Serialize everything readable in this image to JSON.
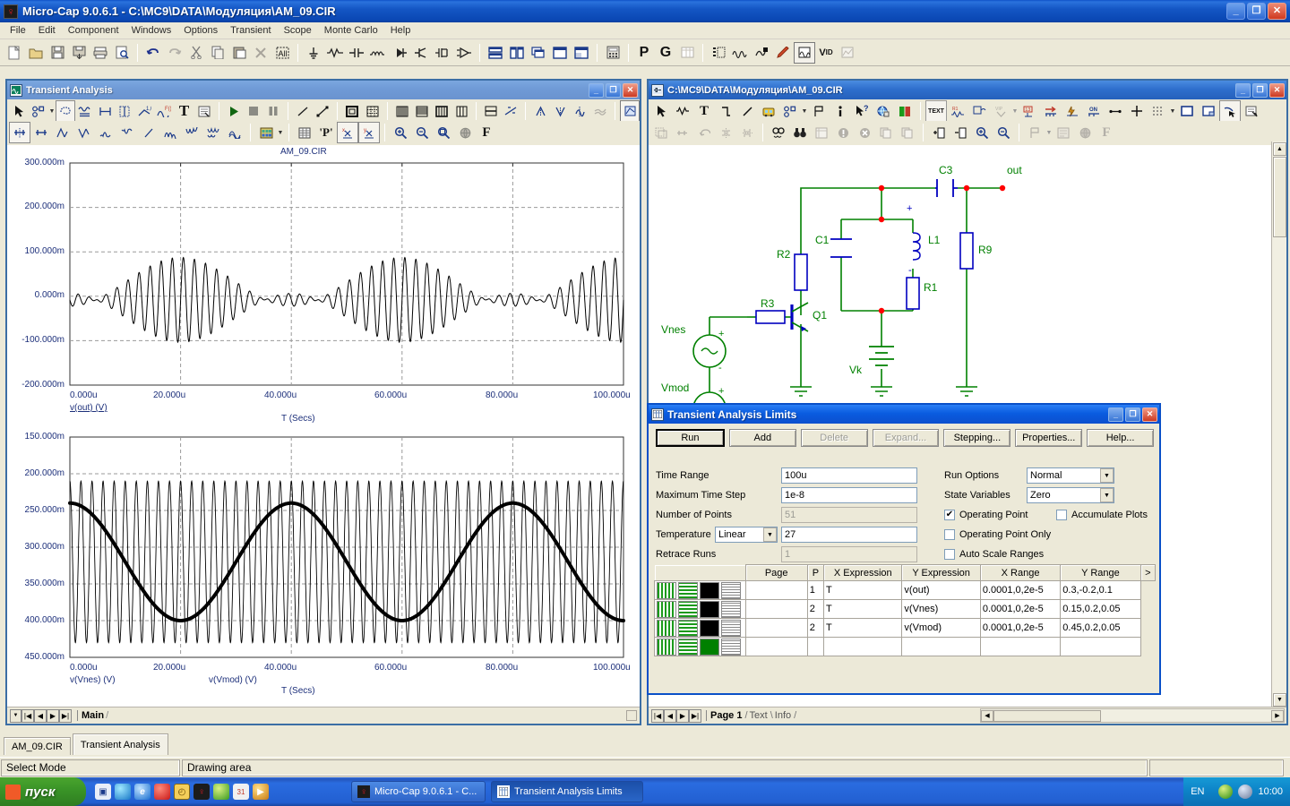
{
  "app": {
    "title": "Micro-Cap 9.0.6.1 - C:\\MC9\\DATA\\Модуляция\\AM_09.CIR",
    "icon": "micro-cap-logo-icon",
    "menu": [
      "File",
      "Edit",
      "Component",
      "Windows",
      "Options",
      "Transient",
      "Scope",
      "Monte Carlo",
      "Help"
    ],
    "min_label": "_",
    "max_label": "❐",
    "close_label": "✕"
  },
  "statusbar": {
    "mode": "Select Mode",
    "area": "Drawing area"
  },
  "doc_tabs": [
    {
      "label": "AM_09.CIR",
      "active": true
    },
    {
      "label": "Transient Analysis",
      "active": false
    }
  ],
  "transient_window": {
    "title": "Transient Analysis",
    "icon": "waveform-window-icon",
    "min_label": "_",
    "max_label": "❐",
    "close_label": "✕",
    "page_tabs": [
      "Main"
    ],
    "plot_title": "AM_09.CIR"
  },
  "chart_data": [
    {
      "type": "line",
      "title": "AM_09.CIR",
      "xlabel": "T (Secs)",
      "ylabel": "",
      "legend": [
        "v(out) (V)"
      ],
      "legend_position": "below-left",
      "grid": true,
      "xlim": [
        0,
        100
      ],
      "xunit": "u",
      "ylim": [
        -200,
        300
      ],
      "yunit": "m",
      "xticks": [
        "0.000u",
        "20.000u",
        "40.000u",
        "60.000u",
        "80.000u",
        "100.000u"
      ],
      "yticks": [
        "300.000m",
        "200.000m",
        "100.000m",
        "0.000m",
        "-100.000m",
        "-200.000m"
      ],
      "y_descending": true,
      "series": [
        {
          "name": "v(out)",
          "description": "Amplitude-modulated carrier: ~20 carrier cycles per 20us envelope, envelope period ~40us",
          "carrier_freq_hz": 500000,
          "envelope_freq_hz": 25000,
          "carrier_amplitude_m": 90,
          "envelope_depth_m": 55,
          "dc_offset_m": -8
        }
      ]
    },
    {
      "type": "line",
      "title": "",
      "xlabel": "T (Secs)",
      "ylabel": "",
      "legend": [
        "v(Vnes) (V)",
        "v(Vmod) (V)"
      ],
      "legend_position": "below",
      "grid": true,
      "xlim": [
        0,
        100
      ],
      "xunit": "u",
      "ylim": [
        150,
        450
      ],
      "yunit": "m",
      "xticks": [
        "0.000u",
        "20.000u",
        "40.000u",
        "60.000u",
        "80.000u",
        "100.000u"
      ],
      "yticks": [
        "150.000m",
        "200.000m",
        "250.000m",
        "300.000m",
        "350.000m",
        "400.000m",
        "450.000m"
      ],
      "y_descending": true,
      "series": [
        {
          "name": "v(Vnes)",
          "description": "High-frequency carrier sine, thin line, constant amplitude",
          "freq_hz": 500000,
          "amplitude_m": 110,
          "center_m": 320,
          "linewidth": 1
        },
        {
          "name": "v(Vmod)",
          "description": "Low-frequency modulating sine, thick line",
          "freq_hz": 25000,
          "amplitude_m": 80,
          "center_m": 320,
          "linewidth": 4
        }
      ]
    }
  ],
  "schematic_window": {
    "title": "C:\\MC9\\DATA\\Модуляция\\AM_09.CIR",
    "icon": "schematic-window-icon",
    "min_label": "_",
    "max_label": "❐",
    "close_label": "✕",
    "page_tabs": [
      "Page 1",
      "Text",
      "Info"
    ],
    "components": [
      {
        "ref": "R2",
        "type": "resistor"
      },
      {
        "ref": "R3",
        "type": "resistor"
      },
      {
        "ref": "R1",
        "type": "resistor"
      },
      {
        "ref": "R9",
        "type": "resistor"
      },
      {
        "ref": "C1",
        "type": "capacitor"
      },
      {
        "ref": "C3",
        "type": "capacitor"
      },
      {
        "ref": "L1",
        "type": "inductor"
      },
      {
        "ref": "Q1",
        "type": "npn-transistor"
      },
      {
        "ref": "Vnes",
        "type": "sine-source"
      },
      {
        "ref": "Vmod",
        "type": "sine-source"
      },
      {
        "ref": "Vk",
        "type": "battery"
      }
    ],
    "nodes": [
      "out"
    ],
    "polarity_marks": [
      "+",
      "-",
      "+",
      "-",
      "+",
      "-"
    ],
    "wire_color": "#008000",
    "part_color": "#0000c0",
    "label_color": "#008000",
    "node_dot_color": "#ff0000"
  },
  "limits_dialog": {
    "title": "Transient Analysis Limits",
    "icon": "analysis-limits-icon",
    "min_label": "_",
    "max_label": "❐",
    "close_label": "✕",
    "buttons": [
      {
        "label": "Run",
        "enabled": true,
        "default": true
      },
      {
        "label": "Add",
        "enabled": true
      },
      {
        "label": "Delete",
        "enabled": false
      },
      {
        "label": "Expand...",
        "enabled": false
      },
      {
        "label": "Stepping...",
        "enabled": true
      },
      {
        "label": "Properties...",
        "enabled": true
      },
      {
        "label": "Help...",
        "enabled": true
      }
    ],
    "fields": {
      "time_range_label": "Time Range",
      "time_range_value": "100u",
      "max_time_step_label": "Maximum Time Step",
      "max_time_step_value": "1e-8",
      "number_of_points_label": "Number of Points",
      "number_of_points_value": "51",
      "number_of_points_enabled": false,
      "temperature_label": "Temperature",
      "temperature_mode": "Linear",
      "temperature_value": "27",
      "retrace_runs_label": "Retrace Runs",
      "retrace_runs_value": "1",
      "retrace_runs_enabled": false
    },
    "options": {
      "run_options_label": "Run Options",
      "run_options_value": "Normal",
      "state_variables_label": "State Variables",
      "state_variables_value": "Zero",
      "checkboxes": [
        {
          "label": "Operating Point",
          "checked": true
        },
        {
          "label": "Accumulate Plots",
          "checked": false
        },
        {
          "label": "Operating Point Only",
          "checked": false
        },
        {
          "label": "Auto Scale Ranges",
          "checked": false
        }
      ]
    },
    "table": {
      "headers": [
        "Page",
        "P",
        "X Expression",
        "Y Expression",
        "X Range",
        "Y Range",
        ">"
      ],
      "rows": [
        {
          "page": "",
          "p": "1",
          "x_expression": "T",
          "y_expression": "v(out)",
          "x_range": "0.0001,0,2e-5",
          "y_range": "0.3,-0.2,0.1",
          "color": "#000000"
        },
        {
          "page": "",
          "p": "2",
          "x_expression": "T",
          "y_expression": "v(Vnes)",
          "x_range": "0.0001,0,2e-5",
          "y_range": "0.15,0.2,0.05",
          "color": "#000000"
        },
        {
          "page": "",
          "p": "2",
          "x_expression": "T",
          "y_expression": "v(Vmod)",
          "x_range": "0.0001,0,2e-5",
          "y_range": "0.45,0.2,0.05",
          "color": "#000000"
        },
        {
          "page": "",
          "p": "",
          "x_expression": "",
          "y_expression": "",
          "x_range": "",
          "y_range": "",
          "color": "#008000"
        }
      ]
    }
  },
  "taskbar": {
    "start_label": "пуск",
    "items": [
      {
        "label": "Micro-Cap 9.0.6.1 - C...",
        "icon": "micro-cap-logo-icon",
        "active": false
      },
      {
        "label": "Transient Analysis Limits",
        "icon": "analysis-limits-icon",
        "active": true
      }
    ],
    "tray": {
      "language": "EN",
      "clock": "10:00",
      "icons": [
        "antivirus-icon",
        "volume-icon"
      ]
    }
  },
  "colors": {
    "titlebar_blue": "#0a47b3",
    "window_face": "#ece9d8",
    "axis_text": "#1c2f7a",
    "wire_green": "#008000",
    "part_blue": "#0000c0",
    "node_red": "#ff0000",
    "taskbar_blue": "#2558c0",
    "start_green": "#399327"
  }
}
